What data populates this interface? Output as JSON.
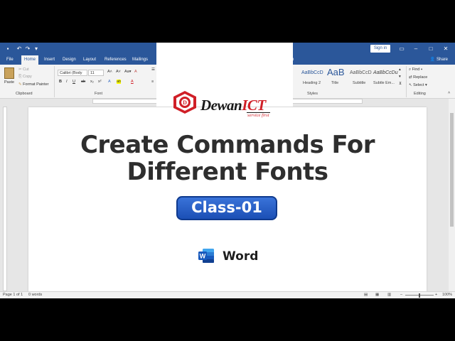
{
  "titlebar": {
    "signin": "Sign in",
    "share": "Share"
  },
  "tabs": [
    "File",
    "Home",
    "Insert",
    "Design",
    "Layout",
    "References",
    "Mailings"
  ],
  "tabs_tail": "o",
  "ribbon": {
    "clipboard": {
      "paste": "Paste",
      "cut": "Cut",
      "copy": "Copy",
      "format_painter": "Format Painter",
      "label": "Clipboard"
    },
    "font": {
      "font_name": "Calibri (Body",
      "font_size": "11",
      "label": "Font"
    },
    "styles": {
      "items": [
        {
          "preview": "AaBbCcD",
          "name": "Heading 2"
        },
        {
          "preview": "AaB",
          "name": "Title"
        },
        {
          "preview": "AaBbCcD",
          "name": "Subtitle"
        },
        {
          "preview": "AaBbCcDu",
          "name": "Subtle Em..."
        }
      ],
      "label": "Styles"
    },
    "editing": {
      "find": "Find",
      "replace": "Replace",
      "select": "Select",
      "label": "Editing"
    }
  },
  "statusbar": {
    "page": "Page 1 of 1",
    "words": "0 words",
    "zoom": "100%"
  },
  "overlay": {
    "logo_main": "Dewan",
    "logo_ict": "ICT",
    "logo_tagline": "service first",
    "headline_line1": "Create Commands For",
    "headline_line2": "Different Fonts",
    "class_label": "Class-01",
    "app_name": "Word"
  },
  "colors": {
    "word_blue": "#2b579a",
    "logo_red": "#d01f27",
    "badge_blue": "#1b4fb5"
  }
}
